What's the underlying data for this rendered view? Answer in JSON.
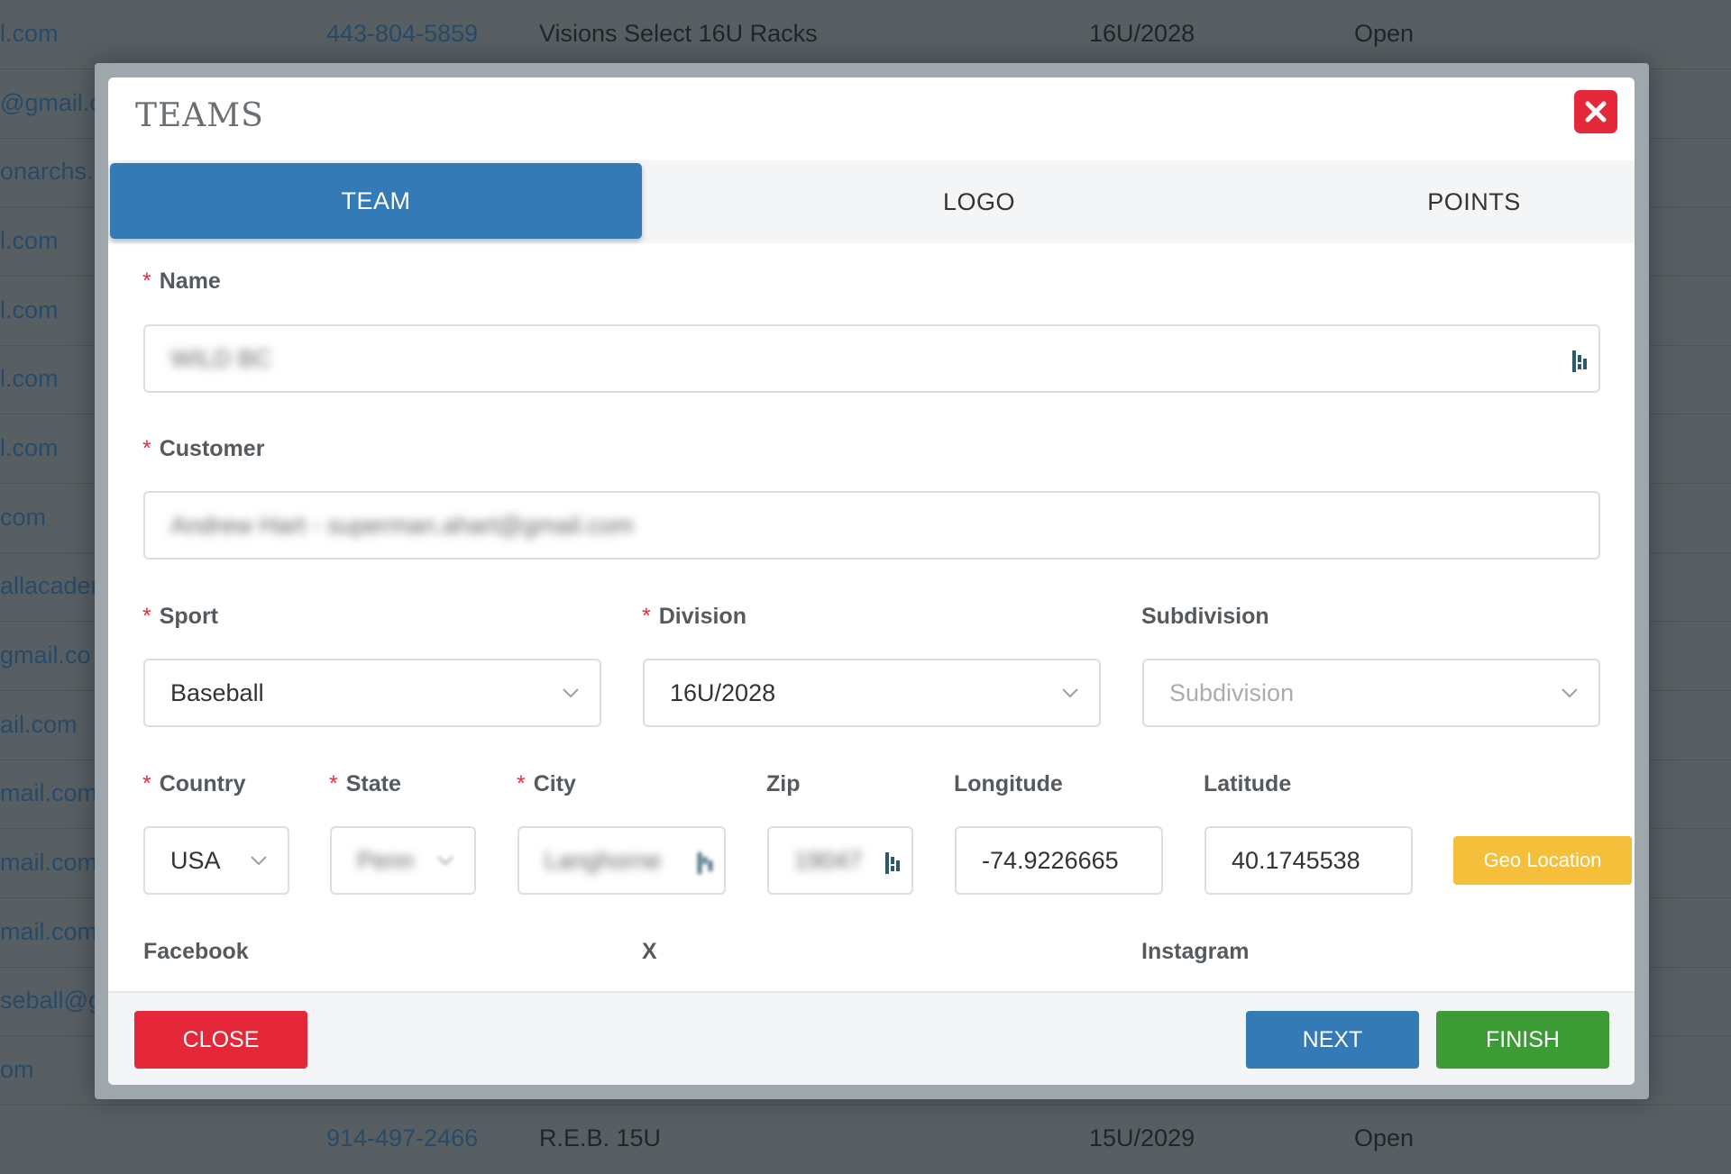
{
  "background_table": {
    "rows": [
      {
        "email": "l.com",
        "phone": "443-804-5859",
        "team": "Visions Select 16U Racks",
        "division": "16U/2028",
        "status": "Open"
      },
      {
        "email": "@gmail.c"
      },
      {
        "email": "onarchs.c"
      },
      {
        "email": "l.com"
      },
      {
        "email": "l.com"
      },
      {
        "email": "l.com"
      },
      {
        "email": "l.com"
      },
      {
        "email": "com"
      },
      {
        "email": "allacader"
      },
      {
        "email": "gmail.co"
      },
      {
        "email": "ail.com"
      },
      {
        "email": "mail.com"
      },
      {
        "email": "mail.com"
      },
      {
        "email": "mail.com"
      },
      {
        "email": "seball@g"
      },
      {
        "email": "om"
      },
      {
        "email": "",
        "phone": "914-497-2466",
        "team": "R.E.B. 15U",
        "division": "15U/2029",
        "status": "Open"
      }
    ]
  },
  "modal": {
    "title": "TEAMS",
    "tabs": [
      {
        "label": "TEAM",
        "active": true
      },
      {
        "label": "LOGO",
        "active": false
      },
      {
        "label": "POINTS",
        "active": false
      }
    ],
    "fields": {
      "name": {
        "label": "Name",
        "required": true,
        "value": "WILD BC"
      },
      "customer": {
        "label": "Customer",
        "required": true,
        "value": "Andrew Hart - superman.ahart@gmail.com"
      },
      "sport": {
        "label": "Sport",
        "required": true,
        "value": "Baseball"
      },
      "division": {
        "label": "Division",
        "required": true,
        "value": "16U/2028"
      },
      "subdivision": {
        "label": "Subdivision",
        "required": false,
        "placeholder": "Subdivision"
      },
      "country": {
        "label": "Country",
        "required": true,
        "value": "USA"
      },
      "state": {
        "label": "State",
        "required": true,
        "value": "Penn"
      },
      "city": {
        "label": "City",
        "required": true,
        "value": "Langhorne"
      },
      "zip": {
        "label": "Zip",
        "required": false,
        "value": "19047"
      },
      "longitude": {
        "label": "Longitude",
        "required": false,
        "value": "-74.9226665"
      },
      "latitude": {
        "label": "Latitude",
        "required": false,
        "value": "40.1745538"
      },
      "facebook": {
        "label": "Facebook"
      },
      "x": {
        "label": "X"
      },
      "instagram": {
        "label": "Instagram"
      }
    },
    "geo_button": "Geo Location",
    "footer": {
      "close": "CLOSE",
      "next": "NEXT",
      "finish": "FINISH"
    },
    "colors": {
      "primary": "#337ab7",
      "danger": "#e4283a",
      "success": "#3c9b35",
      "warning": "#f5bf3c"
    }
  }
}
